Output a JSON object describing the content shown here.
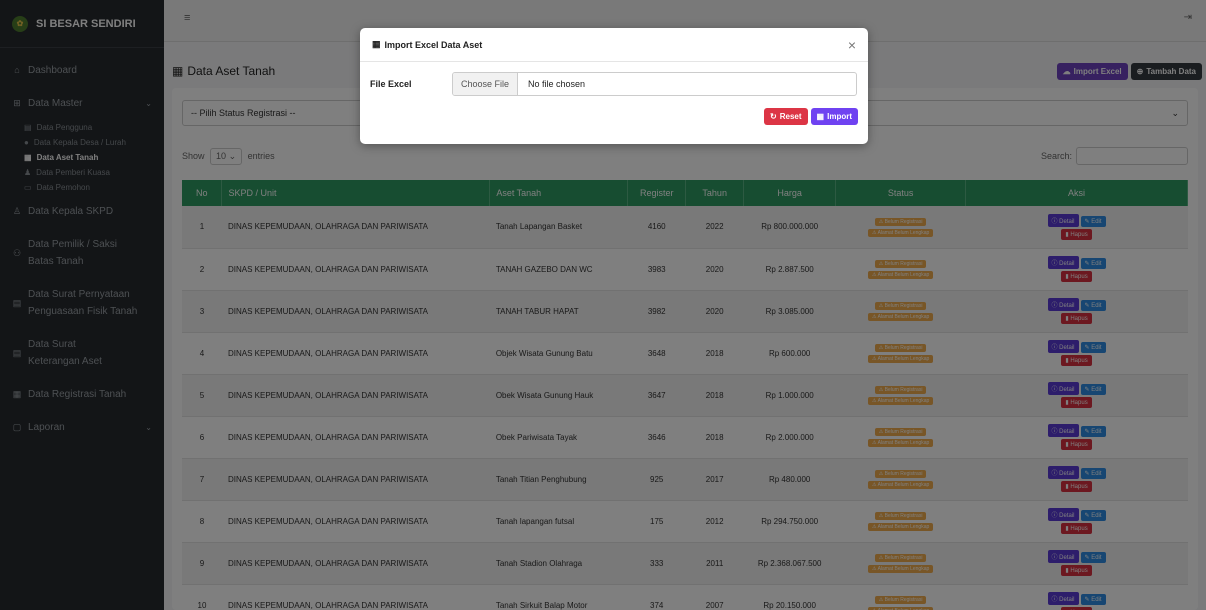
{
  "app": {
    "title": "SI BESAR SENDIRI"
  },
  "sidebar": {
    "dashboard": "Dashboard",
    "data_master": "Data Master",
    "subitems": [
      "Data Pengguna",
      "Data Kepala Desa / Lurah",
      "Data Aset Tanah",
      "Data Pemberi Kuasa",
      "Data Pemohon"
    ],
    "kepala_skpd": "Data Kepala SKPD",
    "pemilik_line1": "Data Pemilik / Saksi",
    "pemilik_line2": "Batas Tanah",
    "surat_pernyataan_line1": "Data Surat Pernyataan",
    "surat_pernyataan_line2": "Penguasaan Fisik Tanah",
    "surat_keterangan_line1": "Data Surat",
    "surat_keterangan_line2": "Keterangan Aset",
    "registrasi": "Data Registrasi Tanah",
    "laporan": "Laporan"
  },
  "page": {
    "title": "Data Aset Tanah",
    "import_btn": "Import Excel",
    "add_btn": "Tambah Data",
    "status_select": "-- Pilih Status Registrasi --",
    "show_label": "Show",
    "entries_value": "10",
    "entries_label": "entries",
    "search_label": "Search:"
  },
  "table": {
    "headers": [
      "No",
      "SKPD / Unit",
      "Aset Tanah",
      "Register",
      "Tahun",
      "Harga",
      "Status",
      "Aksi"
    ],
    "badge1": "Belum Registrasi",
    "badge2": "Alamat Belum Lengkap",
    "act_detail": "Detail",
    "act_edit": "Edit",
    "act_hapus": "Hapus",
    "rows": [
      {
        "no": "1",
        "skpd": "DINAS KEPEMUDAAN, OLAHRAGA DAN PARIWISATA",
        "aset": "Tanah Lapangan Basket",
        "register": "4160",
        "tahun": "2022",
        "harga": "Rp 800.000.000"
      },
      {
        "no": "2",
        "skpd": "DINAS KEPEMUDAAN, OLAHRAGA DAN PARIWISATA",
        "aset": "TANAH GAZEBO DAN WC",
        "register": "3983",
        "tahun": "2020",
        "harga": "Rp 2.887.500"
      },
      {
        "no": "3",
        "skpd": "DINAS KEPEMUDAAN, OLAHRAGA DAN PARIWISATA",
        "aset": "TANAH TABUR HAPAT",
        "register": "3982",
        "tahun": "2020",
        "harga": "Rp 3.085.000"
      },
      {
        "no": "4",
        "skpd": "DINAS KEPEMUDAAN, OLAHRAGA DAN PARIWISATA",
        "aset": "Objek Wisata Gunung Batu",
        "register": "3648",
        "tahun": "2018",
        "harga": "Rp 600.000"
      },
      {
        "no": "5",
        "skpd": "DINAS KEPEMUDAAN, OLAHRAGA DAN PARIWISATA",
        "aset": "Obek Wisata Gunung Hauk",
        "register": "3647",
        "tahun": "2018",
        "harga": "Rp 1.000.000"
      },
      {
        "no": "6",
        "skpd": "DINAS KEPEMUDAAN, OLAHRAGA DAN PARIWISATA",
        "aset": "Obek Pariwisata Tayak",
        "register": "3646",
        "tahun": "2018",
        "harga": "Rp 2.000.000"
      },
      {
        "no": "7",
        "skpd": "DINAS KEPEMUDAAN, OLAHRAGA DAN PARIWISATA",
        "aset": "Tanah Titian Penghubung",
        "register": "925",
        "tahun": "2017",
        "harga": "Rp 480.000"
      },
      {
        "no": "8",
        "skpd": "DINAS KEPEMUDAAN, OLAHRAGA DAN PARIWISATA",
        "aset": "Tanah lapangan futsal",
        "register": "175",
        "tahun": "2012",
        "harga": "Rp 294.750.000"
      },
      {
        "no": "9",
        "skpd": "DINAS KEPEMUDAAN, OLAHRAGA DAN PARIWISATA",
        "aset": "Tanah Stadion Olahraga",
        "register": "333",
        "tahun": "2011",
        "harga": "Rp 2.368.067.500"
      },
      {
        "no": "10",
        "skpd": "DINAS KEPEMUDAAN, OLAHRAGA DAN PARIWISATA",
        "aset": "Tanah Sirkuit Balap Motor",
        "register": "374",
        "tahun": "2007",
        "harga": "Rp 20.150.000"
      }
    ]
  },
  "modal": {
    "title": "Import Excel Data Aset",
    "file_label": "File Excel",
    "choose_btn": "Choose File",
    "file_status": "No file chosen",
    "reset_btn": "Reset",
    "import_btn": "Import"
  }
}
